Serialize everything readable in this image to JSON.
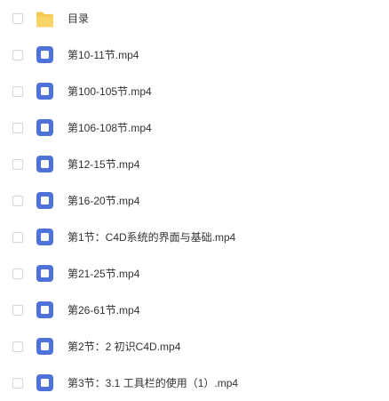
{
  "colors": {
    "folder": "#f6c84b",
    "video_icon": "#4f72d8",
    "text": "#333333",
    "checkbox_border": "#d6d6d6"
  },
  "files": [
    {
      "name": "目录",
      "icon": "folder-icon"
    },
    {
      "name": "第10-11节.mp4",
      "icon": "video-file-icon"
    },
    {
      "name": "第100-105节.mp4",
      "icon": "video-file-icon"
    },
    {
      "name": "第106-108节.mp4",
      "icon": "video-file-icon"
    },
    {
      "name": "第12-15节.mp4",
      "icon": "video-file-icon"
    },
    {
      "name": "第16-20节.mp4",
      "icon": "video-file-icon"
    },
    {
      "name": "第1节：C4D系统的界面与基础.mp4",
      "icon": "video-file-icon"
    },
    {
      "name": "第21-25节.mp4",
      "icon": "video-file-icon"
    },
    {
      "name": "第26-61节.mp4",
      "icon": "video-file-icon"
    },
    {
      "name": "第2节：2 初识C4D.mp4",
      "icon": "video-file-icon"
    },
    {
      "name": "第3节：3.1 工具栏的使用（1）.mp4",
      "icon": "video-file-icon"
    }
  ]
}
